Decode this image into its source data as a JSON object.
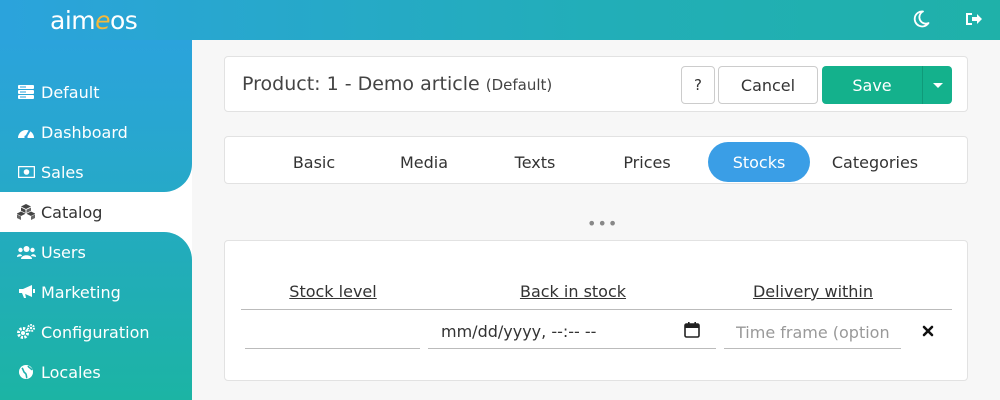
{
  "app": {
    "logo": {
      "part1": "aim",
      "part2": "e",
      "part3": "os"
    },
    "dark_mode_icon": "moon-icon",
    "logout_icon": "logout-icon"
  },
  "sidebar": {
    "items": [
      {
        "label": "Default",
        "icon": "server-icon"
      },
      {
        "label": "Dashboard",
        "icon": "gauge-icon"
      },
      {
        "label": "Sales",
        "icon": "money-icon"
      },
      {
        "label": "Catalog",
        "icon": "cubes-icon",
        "active": true
      },
      {
        "label": "Users",
        "icon": "users-icon"
      },
      {
        "label": "Marketing",
        "icon": "bullhorn-icon"
      },
      {
        "label": "Configuration",
        "icon": "gears-icon"
      },
      {
        "label": "Locales",
        "icon": "globe-icon"
      }
    ]
  },
  "header": {
    "title": "Product: 1 - Demo article",
    "site": "(Default)",
    "help_label": "?",
    "cancel_label": "Cancel",
    "save_label": "Save"
  },
  "tabs": [
    {
      "label": "Basic"
    },
    {
      "label": "Media"
    },
    {
      "label": "Texts"
    },
    {
      "label": "Prices"
    },
    {
      "label": "Stocks",
      "active": true
    },
    {
      "label": "Categories"
    }
  ],
  "more_label": "•••",
  "stock": {
    "columns": [
      "Stock level",
      "Back in stock",
      "Delivery within"
    ],
    "row": {
      "stock_level": "",
      "back_in_stock": "mm/dd/yyyy, --:-- --",
      "delivery_placeholder": "Time frame (optional)"
    }
  },
  "colors": {
    "primary": "#2ba3dc",
    "accent": "#14b18c",
    "tab_active": "#3a9ee6"
  }
}
